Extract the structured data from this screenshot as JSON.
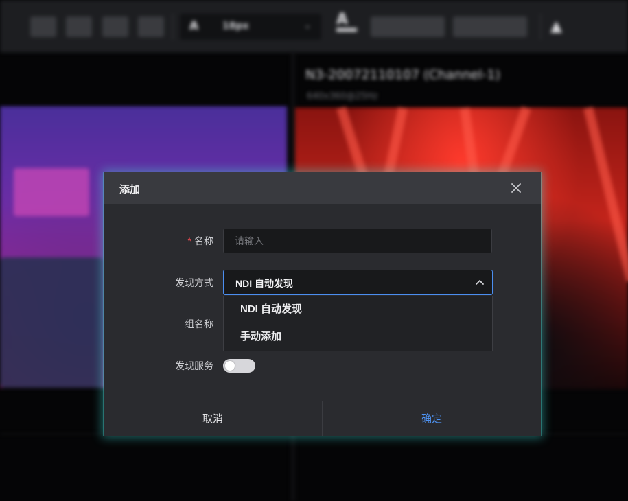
{
  "background": {
    "toolbar": {
      "font_size_value": "18px",
      "text_color_icon": "text-color-icon",
      "alert_icon": "warning-icon"
    },
    "stream": {
      "title": "N3-20072110107 (Channel-1)",
      "subtitle": "640x360@25Hz"
    }
  },
  "dialog": {
    "title": "添加",
    "close_icon": "close-icon",
    "fields": {
      "name": {
        "required_mark": "*",
        "label": "名称",
        "placeholder": "请输入",
        "value": ""
      },
      "discovery": {
        "label": "发现方式",
        "selected": "NDI 自动发现",
        "options": [
          "NDI 自动发现",
          "手动添加"
        ],
        "expanded": true
      },
      "group_name": {
        "label": "组名称"
      },
      "discovery_service": {
        "label": "发现服务",
        "enabled": false
      }
    },
    "buttons": {
      "cancel": "取消",
      "confirm": "确定"
    },
    "colors": {
      "confirm_text": "#4f94f4",
      "cancel_text": "#e6e6e9",
      "focus_border": "#4b8ef0",
      "required": "#e5484d",
      "glow": "#40dcd7"
    }
  }
}
